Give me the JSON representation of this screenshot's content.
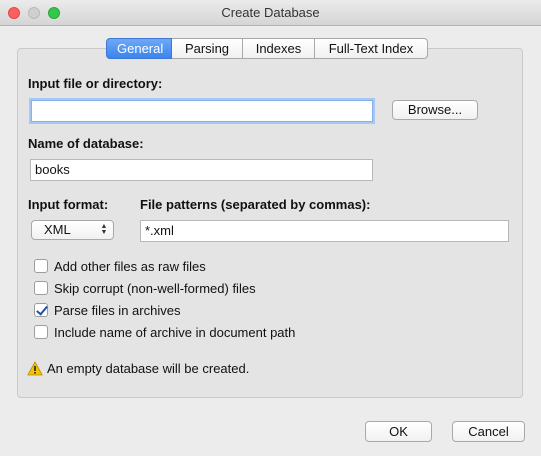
{
  "window": {
    "title": "Create Database"
  },
  "tabs": [
    {
      "label": "General",
      "active": true
    },
    {
      "label": "Parsing",
      "active": false
    },
    {
      "label": "Indexes",
      "active": false
    },
    {
      "label": "Full-Text Index",
      "active": false
    }
  ],
  "general": {
    "input_label": "Input file or directory:",
    "input_value": "",
    "browse_label": "Browse...",
    "name_label": "Name of database:",
    "name_value": "books",
    "format_label": "Input format:",
    "format_value": "XML",
    "patterns_label": "File patterns (separated by commas):",
    "patterns_value": "*.xml",
    "options": [
      {
        "label": "Add other files as raw files",
        "checked": false
      },
      {
        "label": "Skip corrupt (non-well-formed) files",
        "checked": false
      },
      {
        "label": "Parse files in archives",
        "checked": true
      },
      {
        "label": "Include name of archive in document path",
        "checked": false
      }
    ],
    "status_icon": "warning-icon",
    "status_text": "An empty database will be created."
  },
  "footer": {
    "ok_label": "OK",
    "cancel_label": "Cancel"
  },
  "colors": {
    "accent": "#3a84ee",
    "warning": "#f5c400"
  }
}
